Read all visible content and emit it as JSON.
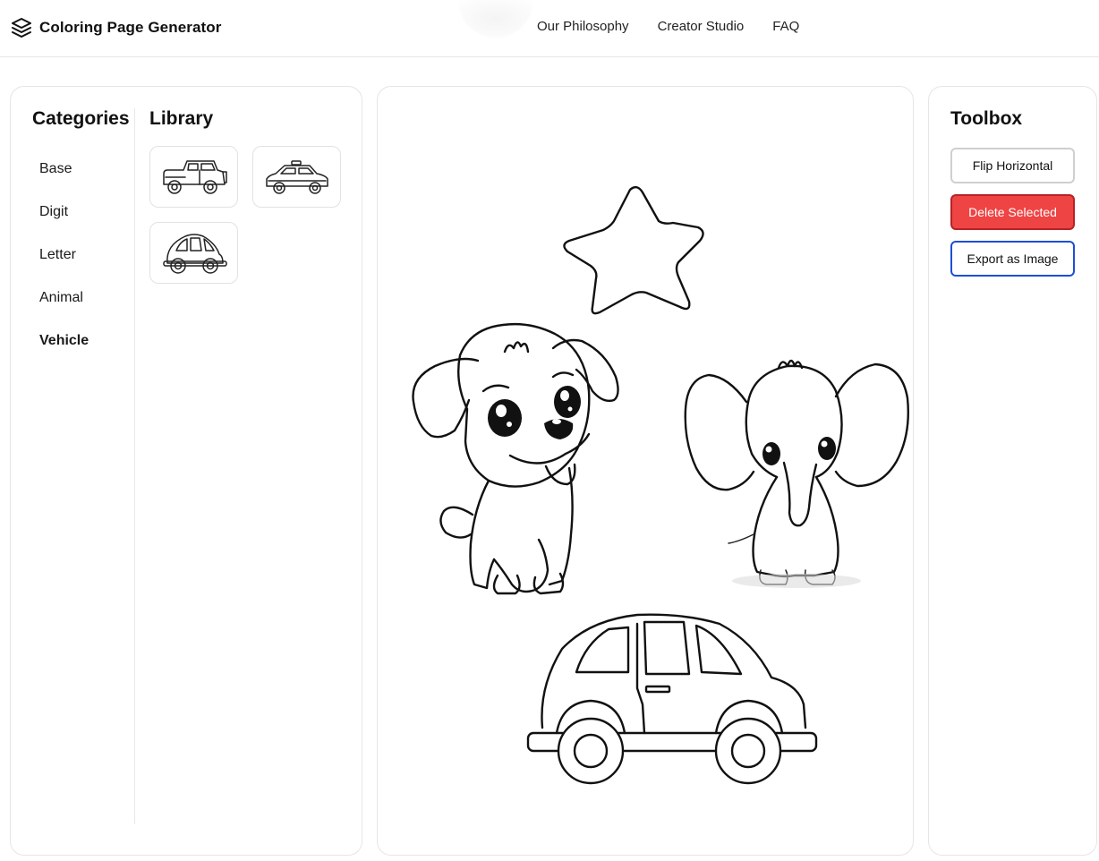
{
  "header": {
    "app_title": "Coloring Page Generator",
    "logo_icon": "layers-icon",
    "nav": [
      {
        "label": "Our Philosophy"
      },
      {
        "label": "Creator Studio"
      },
      {
        "label": "FAQ"
      }
    ]
  },
  "categories": {
    "title": "Categories",
    "items": [
      {
        "label": "Base"
      },
      {
        "label": "Digit"
      },
      {
        "label": "Letter"
      },
      {
        "label": "Animal"
      },
      {
        "label": "Vehicle",
        "active": true
      }
    ]
  },
  "library": {
    "title": "Library",
    "items": [
      {
        "icon": "jeep-icon"
      },
      {
        "icon": "taxi-icon"
      },
      {
        "icon": "beetle-car-icon"
      }
    ]
  },
  "canvas": {
    "items": [
      "star-outline",
      "puppy-drawing",
      "elephant-drawing",
      "car-drawing"
    ]
  },
  "toolbox": {
    "title": "Toolbox",
    "flip_label": "Flip Horizontal",
    "delete_label": "Delete Selected",
    "export_label": "Export as Image"
  },
  "colors": {
    "delete_bg": "#ef4444",
    "export_border": "#1d4ed8",
    "panel_border": "#e5e5e5"
  }
}
